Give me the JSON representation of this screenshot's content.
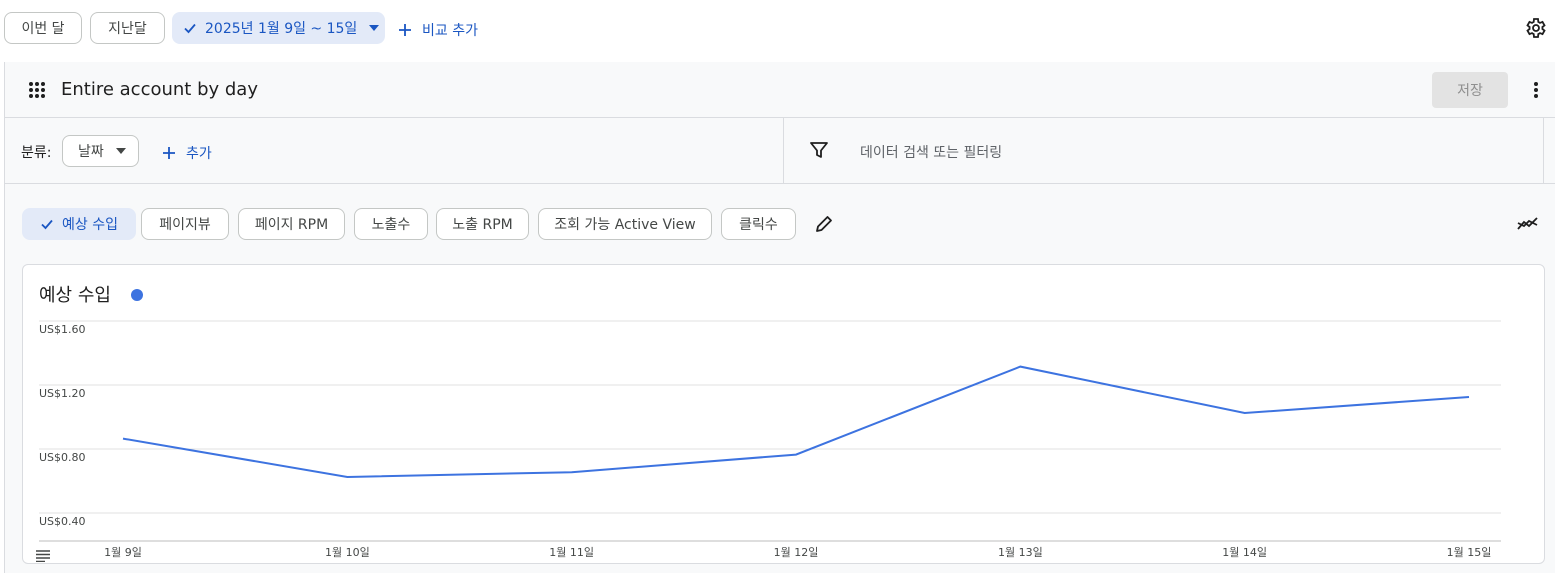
{
  "top_bar": {
    "this_month": "이번 달",
    "last_month": "지난달",
    "date_range": "2025년 1월 9일 ~ 15일",
    "add_compare": "비교 추가"
  },
  "report": {
    "title": "Entire account by day",
    "save": "저장"
  },
  "filters": {
    "breakdown_label": "분류:",
    "breakdown_value": "날짜",
    "add": "추가",
    "search_placeholder": "데이터 검색 또는 필터링"
  },
  "metrics": [
    {
      "label": "예상 수입",
      "selected": true
    },
    {
      "label": "페이지뷰",
      "selected": false
    },
    {
      "label": "페이지 RPM",
      "selected": false
    },
    {
      "label": "노출수",
      "selected": false
    },
    {
      "label": "노출 RPM",
      "selected": false
    },
    {
      "label": "조회 가능 Active View",
      "selected": false
    },
    {
      "label": "클릭수",
      "selected": false
    }
  ],
  "colors": {
    "accent": "#1a56c2",
    "series": "#3d73e0",
    "selected_bg": "#e3eaf8"
  },
  "chart_data": {
    "type": "line",
    "title": "예상 수입",
    "x": [
      "1월 9일",
      "1월 10일",
      "1월 11일",
      "1월 12일",
      "1월 13일",
      "1월 14일",
      "1월 15일"
    ],
    "series": [
      {
        "values": [
          0.94,
          0.7,
          0.73,
          0.84,
          1.39,
          1.1,
          1.2
        ]
      }
    ],
    "y_ticks": [
      "US$0.40",
      "US$0.80",
      "US$1.20",
      "US$1.60"
    ],
    "ylim": [
      0.3,
      1.6
    ],
    "grid": true
  }
}
